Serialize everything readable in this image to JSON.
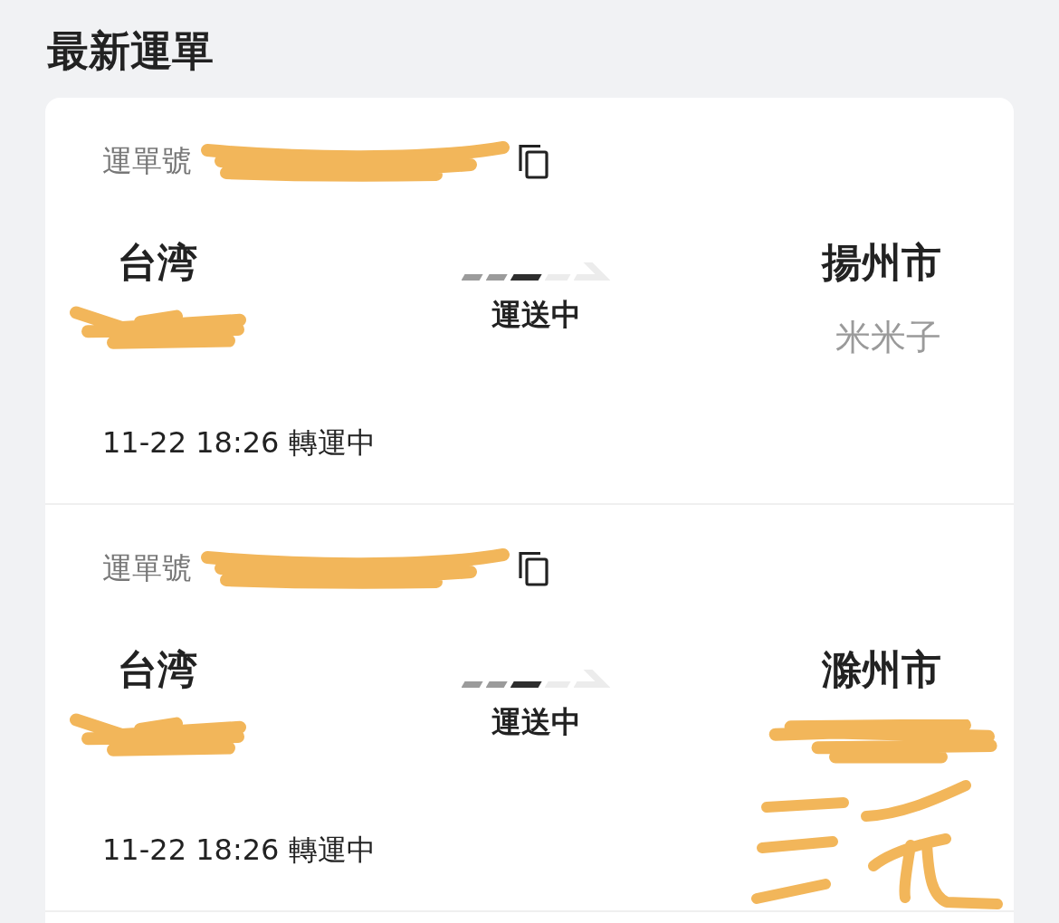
{
  "page_title": "最新運單",
  "shipments": [
    {
      "tracking_label": "運單號",
      "tracking_number": {
        "redacted": true
      },
      "origin": {
        "city": "台湾",
        "contact": {
          "redacted": true
        }
      },
      "transit": {
        "steps": [
          {
            "reached": true,
            "current": false
          },
          {
            "reached": true,
            "current": false
          },
          {
            "reached": true,
            "current": true
          },
          {
            "reached": false,
            "current": false
          },
          {
            "reached": false,
            "current": false
          }
        ],
        "status": "運送中"
      },
      "destination": {
        "city": "揚州市",
        "contact": {
          "name": "米米子"
        }
      },
      "latest_update": "11-22 18:26 轉運中"
    },
    {
      "tracking_label": "運單號",
      "tracking_number": {
        "redacted": true
      },
      "origin": {
        "city": "台湾",
        "contact": {
          "redacted": true
        }
      },
      "transit": {
        "steps": [
          {
            "reached": true,
            "current": false
          },
          {
            "reached": true,
            "current": false
          },
          {
            "reached": true,
            "current": true
          },
          {
            "reached": false,
            "current": false
          },
          {
            "reached": false,
            "current": false
          }
        ],
        "status": "運送中"
      },
      "destination": {
        "city": "滁州市",
        "contact": {
          "redacted": true,
          "doodle": true
        }
      },
      "latest_update": "11-22 18:26 轉運中"
    }
  ]
}
